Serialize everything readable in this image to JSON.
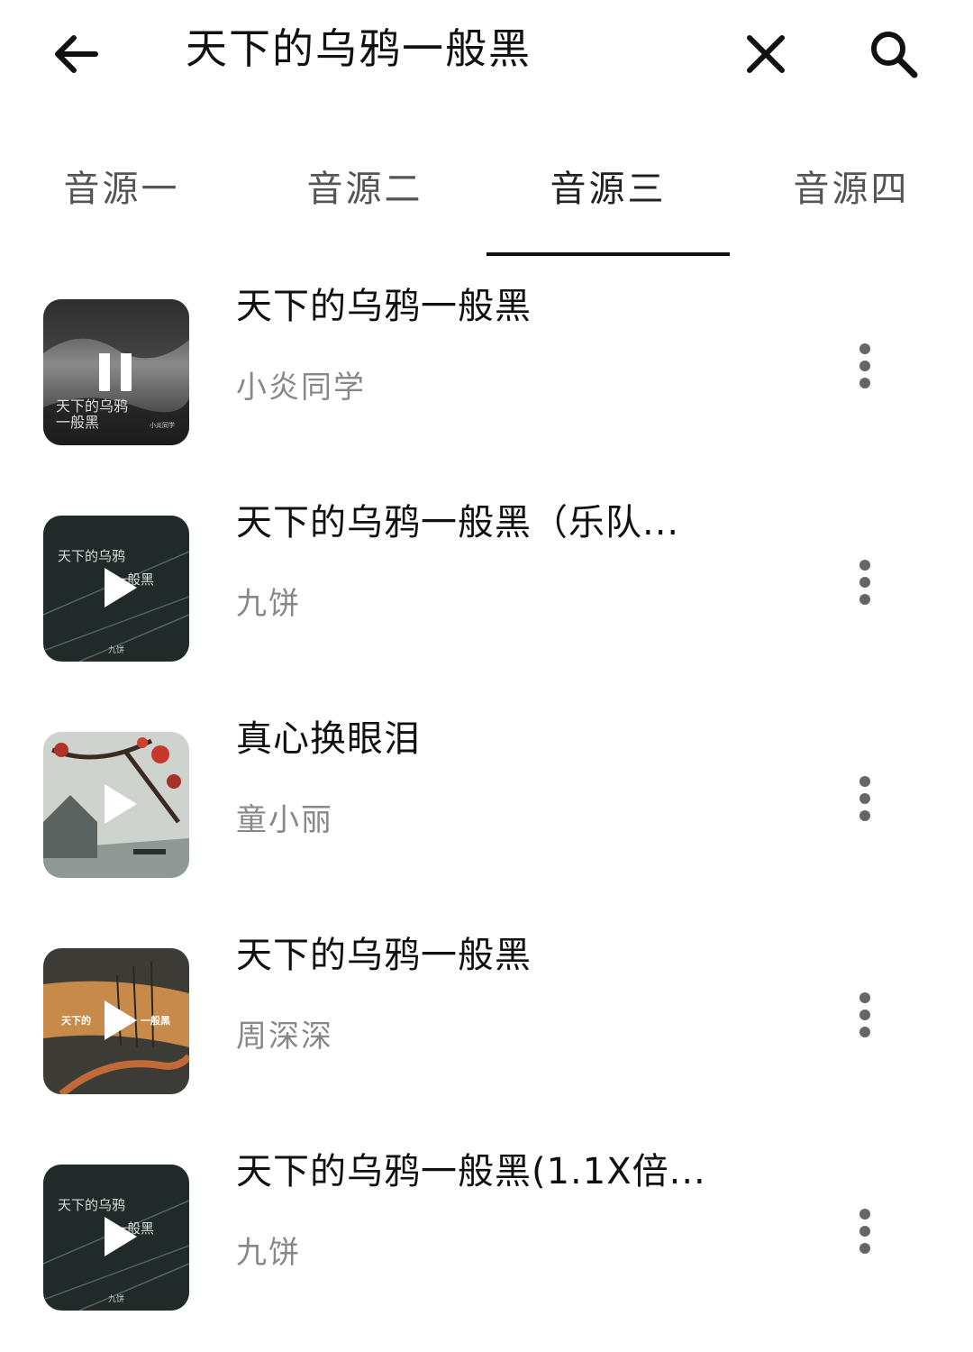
{
  "search": {
    "query": "天下的乌鸦一般黑"
  },
  "tabs": [
    {
      "label": "音源一",
      "active": false
    },
    {
      "label": "音源二",
      "active": false
    },
    {
      "label": "音源三",
      "active": true
    },
    {
      "label": "音源四",
      "active": false
    }
  ],
  "songs": [
    {
      "title": "天下的乌鸦一般黑",
      "artist": "小炎同学",
      "state": "playing",
      "cover": {
        "line1": "天下的乌鸦",
        "line2": "一般黑",
        "credit": "小炎同学"
      }
    },
    {
      "title": "天下的乌鸦一般黑（乐队...",
      "artist": "九饼",
      "state": "paused",
      "cover": {
        "line1": "天下的乌鸦",
        "line2": "一般黑",
        "credit": "九饼"
      }
    },
    {
      "title": "真心换眼泪",
      "artist": "童小丽",
      "state": "paused"
    },
    {
      "title": "天下的乌鸦一般黑",
      "artist": "周深深",
      "state": "paused",
      "cover": {
        "line1": "天下的",
        "line2": "一般黑"
      }
    },
    {
      "title": "天下的乌鸦一般黑(1.1X倍...",
      "artist": "九饼",
      "state": "paused",
      "cover": {
        "line1": "天下的乌鸦",
        "line2": "一般黑",
        "credit": "九饼"
      }
    }
  ],
  "icons": {
    "back": "arrow-left-icon",
    "clear": "close-icon",
    "search": "search-icon",
    "more": "more-vertical-icon",
    "pause": "pause-icon",
    "play": "play-icon"
  },
  "colors": {
    "indicator": "#111111",
    "title_text": "#111111",
    "artist_text": "#888888",
    "tab_text": "#555555"
  }
}
